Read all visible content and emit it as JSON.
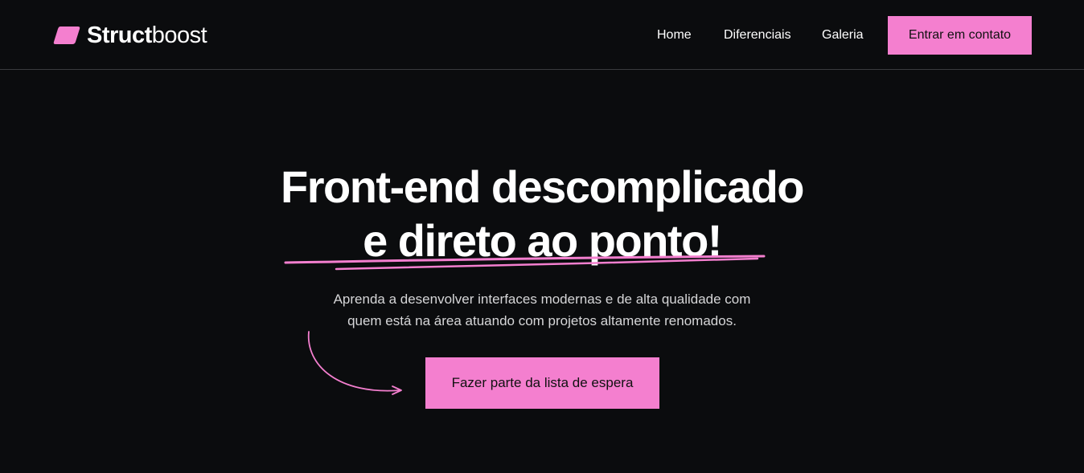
{
  "brand": {
    "name_bold": "Struct",
    "name_light": "boost",
    "logo_icon": "pink-hexagon-logo-icon",
    "accent_color": "#f47fcf"
  },
  "nav": {
    "items": [
      {
        "label": "Home"
      },
      {
        "label": "Diferenciais"
      },
      {
        "label": "Galeria"
      }
    ],
    "cta_label": "Entrar em contato"
  },
  "hero": {
    "title_line1": "Front-end descomplicado",
    "title_line2": "e direto ao ponto!",
    "subtitle_line1": "Aprenda a desenvolver interfaces modernas e de alta qualidade com",
    "subtitle_line2": "quem está na área atuando com projetos altamente renomados.",
    "cta_label": "Fazer parte da lista de espera",
    "decorations": [
      "underline-scribble",
      "curved-arrow-icon"
    ]
  }
}
